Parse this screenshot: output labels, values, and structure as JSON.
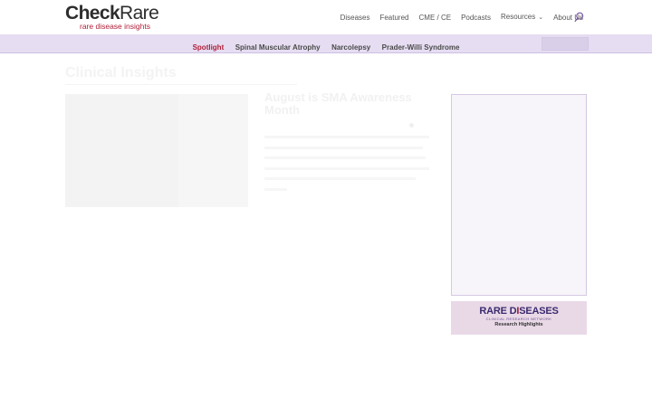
{
  "brand": {
    "name_part1": "Check",
    "name_part2": "Rare",
    "tagline": "rare disease insights"
  },
  "nav": {
    "items": [
      {
        "label": "Diseases"
      },
      {
        "label": "Featured"
      },
      {
        "label": "CME / CE"
      },
      {
        "label": "Podcasts"
      },
      {
        "label": "Resources"
      },
      {
        "label": "About Us"
      }
    ],
    "resources_has_dropdown": true,
    "search_icon": "search-icon"
  },
  "subnav": {
    "items": [
      {
        "label": "Spotlight",
        "active": true
      },
      {
        "label": "Spinal Muscular Atrophy",
        "active": false
      },
      {
        "label": "Narcolepsy",
        "active": false
      },
      {
        "label": "Prader-Willi Syndrome",
        "active": false
      }
    ]
  },
  "main": {
    "section_title": "Clinical Insights",
    "article": {
      "image_caption": "",
      "title": "August is SMA Awareness Month"
    }
  },
  "sidebar": {
    "banner": {
      "logo_part1": "RARE D",
      "logo_part2": "I",
      "logo_part3": "SEASES",
      "subtitle": "CLINICAL RESEARCH NETWORK",
      "footer": "Research Highlights"
    }
  },
  "colors": {
    "accent": "#b0203a",
    "subnav_bg": "#e6ddf2",
    "brand_dark": "#2d2d2d"
  }
}
